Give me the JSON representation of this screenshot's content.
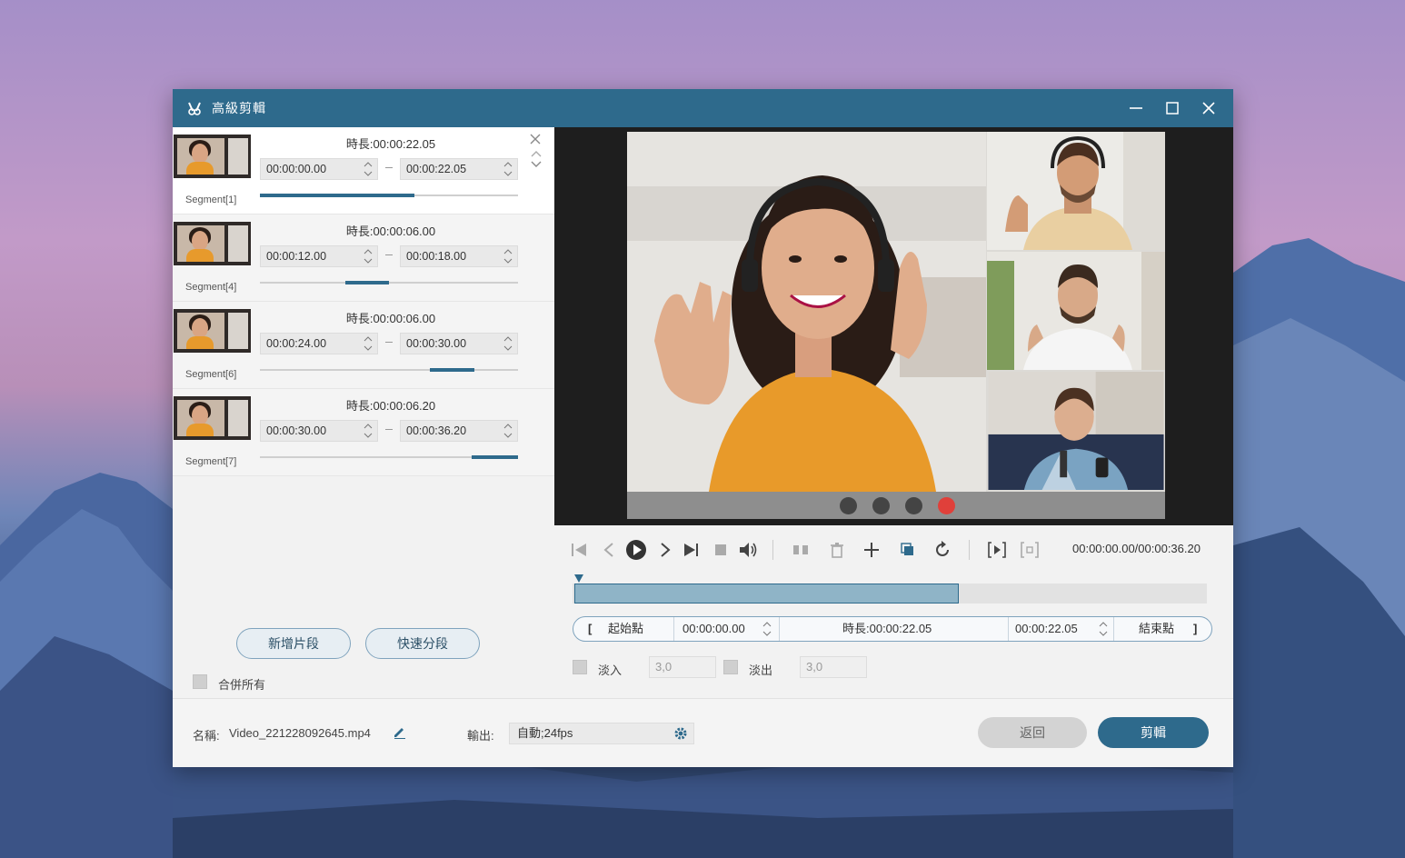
{
  "window": {
    "title": "高級剪輯",
    "minimize_icon": "minimize-icon",
    "maximize_icon": "maximize-icon",
    "close_icon": "close-icon"
  },
  "segments": [
    {
      "name": "Segment[1]",
      "duration": "時長:00:00:22.05",
      "start": "00:00:00.00",
      "end": "00:00:22.05",
      "fill": [
        0.0,
        0.6
      ]
    },
    {
      "name": "Segment[4]",
      "duration": "時長:00:00:06.00",
      "start": "00:00:12.00",
      "end": "00:00:18.00",
      "fill": [
        0.33,
        0.5
      ]
    },
    {
      "name": "Segment[6]",
      "duration": "時長:00:00:06.00",
      "start": "00:00:24.00",
      "end": "00:00:30.00",
      "fill": [
        0.66,
        0.83
      ]
    },
    {
      "name": "Segment[7]",
      "duration": "時長:00:00:06.20",
      "start": "00:00:30.00",
      "end": "00:00:36.20",
      "fill": [
        0.82,
        1.0
      ]
    }
  ],
  "left_panel": {
    "add_segment_label": "新增片段",
    "quick_split_label": "快速分段",
    "merge_all_label": "合併所有"
  },
  "player": {
    "time_readout": "00:00:00.00/00:00:36.20",
    "selection_fraction": [
      0.0,
      0.61
    ]
  },
  "range": {
    "start_point_label": "起始點",
    "start_value": "00:00:00.00",
    "duration": "時長:00:00:22.05",
    "end_value": "00:00:22.05",
    "end_point_label": "結束點"
  },
  "fade": {
    "fade_in_label": "淡入",
    "fade_in_value": "3,0",
    "fade_out_label": "淡出",
    "fade_out_value": "3,0"
  },
  "bottom": {
    "name_label": "名稱:",
    "filename": "Video_221228092645.mp4",
    "output_label": "輸出:",
    "output_value": "自動;24fps",
    "back_label": "返回",
    "cut_label": "剪輯"
  },
  "colors": {
    "titlebar": "#2e6a8c",
    "accent": "#2e6a8c",
    "record_red": "#e0403a"
  }
}
